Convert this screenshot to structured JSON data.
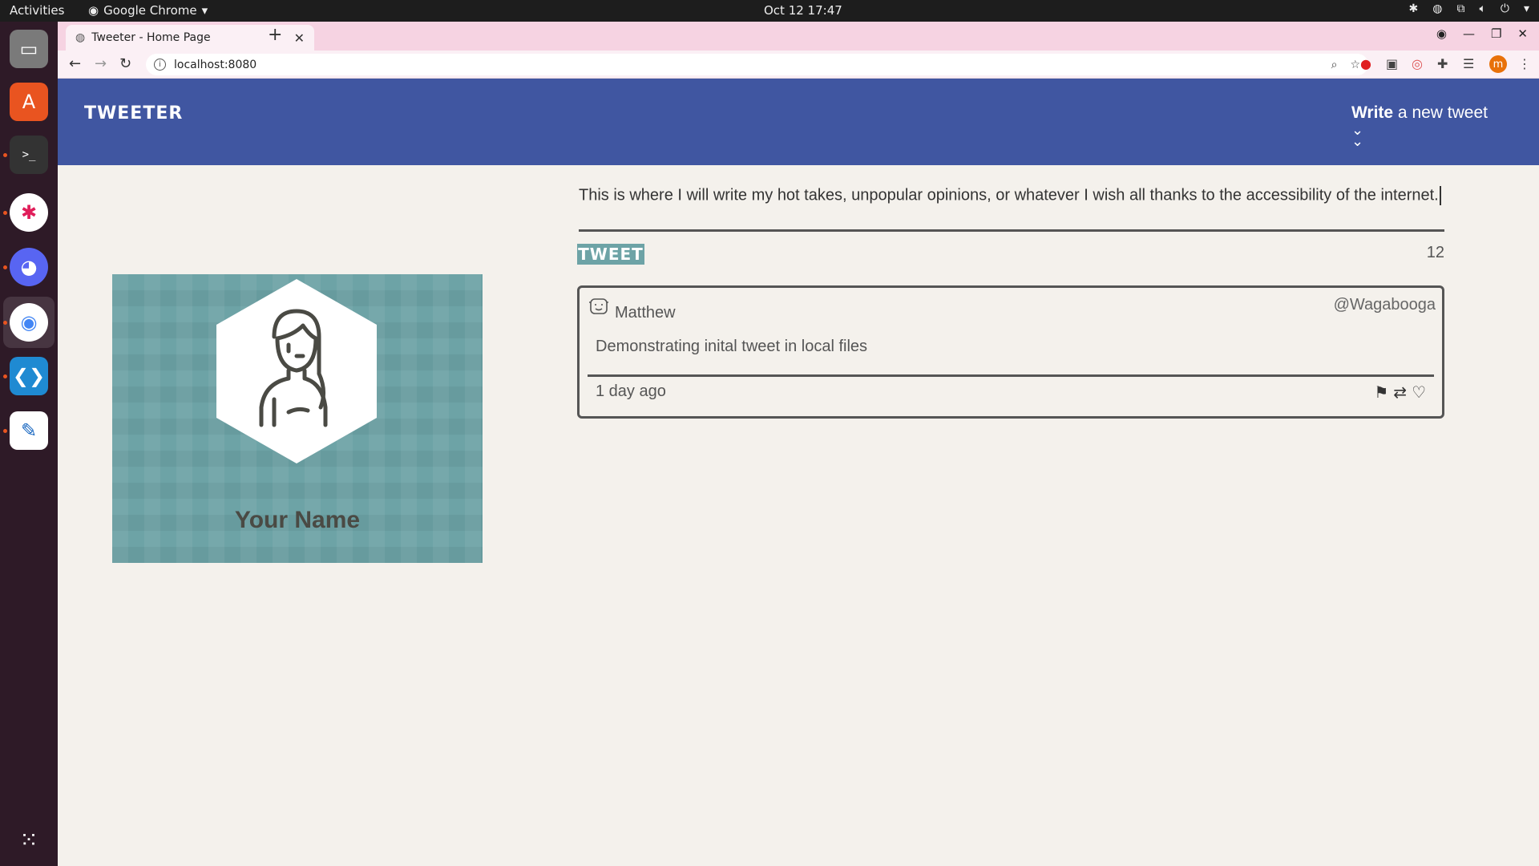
{
  "os": {
    "activities": "Activities",
    "app_menu": "Google Chrome",
    "clock": "Oct 12  17:47"
  },
  "browser": {
    "tab_title": "Tweeter - Home Page",
    "url": "localhost:8080",
    "profile_initial": "m"
  },
  "header": {
    "brand": "TWEETER",
    "compose_bold": "Write",
    "compose_rest": " a new tweet"
  },
  "profile": {
    "name": "Your Name"
  },
  "composer": {
    "text": "This is where I will write my hot takes, unpopular opinions, or whatever I wish all thanks to the accessibility of the internet.",
    "button_label": "TWEET",
    "counter": "12"
  },
  "tweets": [
    {
      "author": "Matthew",
      "handle": "@Wagabooga",
      "content": "Demonstrating inital tweet in local files",
      "time": "1 day ago"
    }
  ],
  "colors": {
    "header_bg": "#4056a1",
    "accent": "#6da3a6",
    "page_bg": "#f4f1ec"
  }
}
